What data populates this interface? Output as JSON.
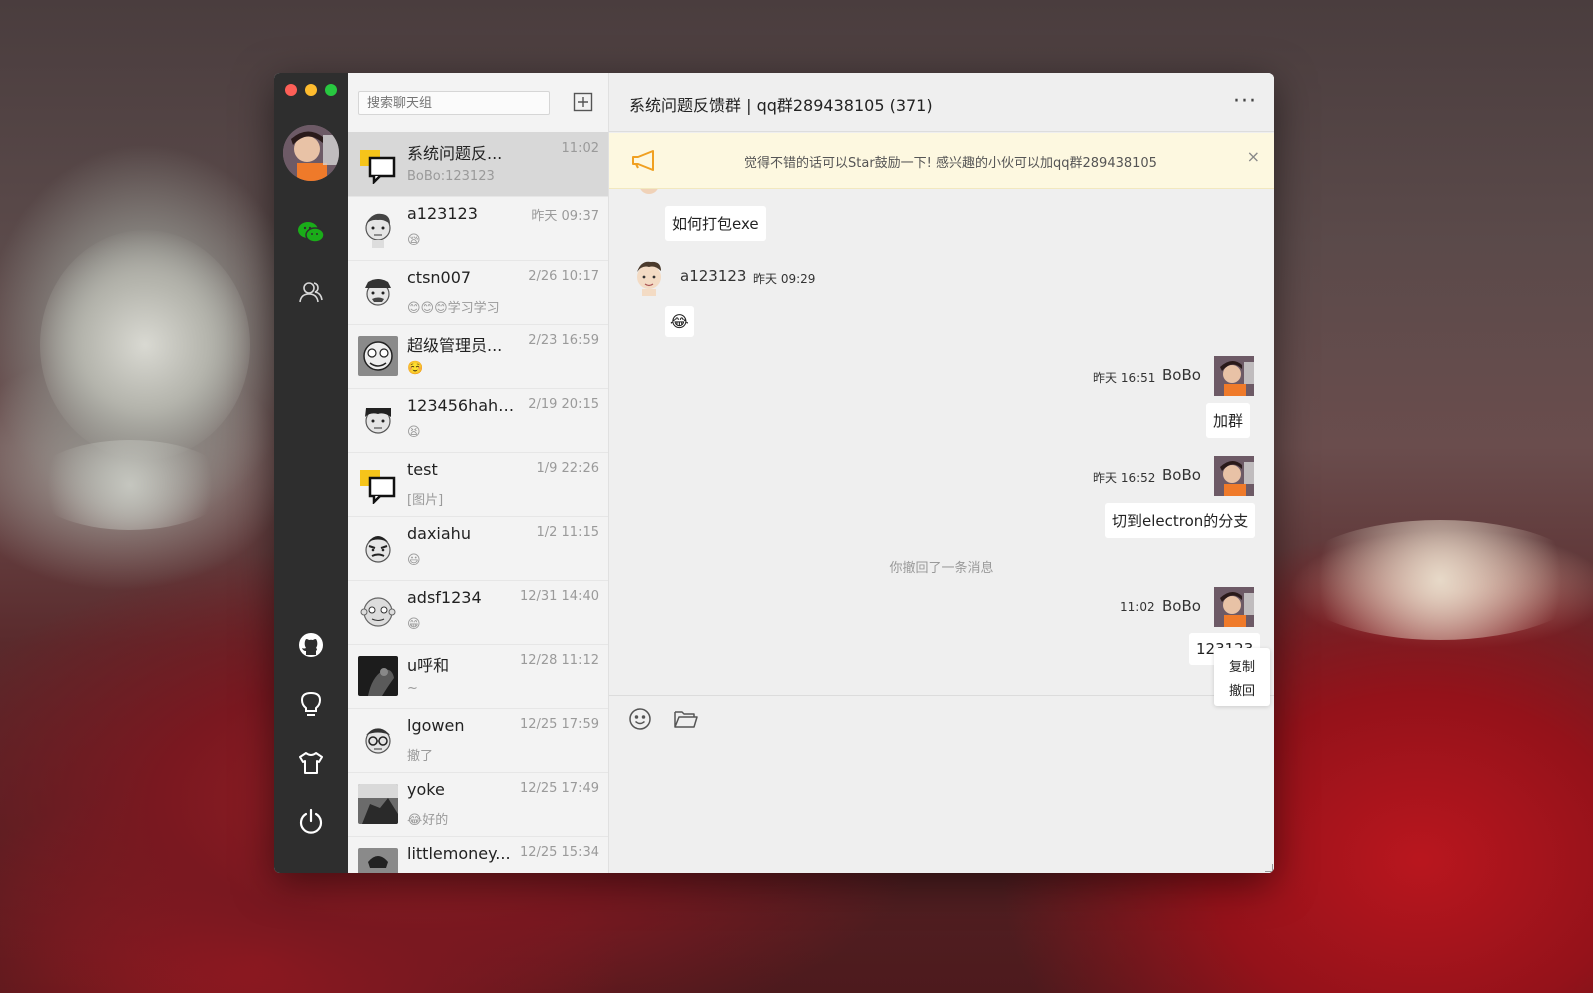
{
  "window": {
    "traffic_lights": [
      "#fd5f57",
      "#febc2e",
      "#28c840"
    ]
  },
  "sidebar": {
    "icons": [
      "wechat-icon",
      "contacts-icon",
      "github-icon",
      "bulb-icon",
      "tshirt-icon",
      "power-icon"
    ]
  },
  "search": {
    "placeholder": "搜索聊天组"
  },
  "conversations": [
    {
      "name": "系统问题反...",
      "time": "11:02",
      "msg": "BoBo:123123",
      "emoji": ""
    },
    {
      "name": "a123123",
      "time": "昨天 09:37",
      "msg": "",
      "emoji": "😪"
    },
    {
      "name": "ctsn007",
      "time": "2/26 10:17",
      "msg": "学习学习",
      "emoji": "😊😊😊"
    },
    {
      "name": "超级管理员...",
      "time": "2/23 16:59",
      "msg": "",
      "emoji": "☺️"
    },
    {
      "name": "123456haha...",
      "time": "2/19 20:15",
      "msg": "",
      "emoji": "😫"
    },
    {
      "name": "test",
      "time": "1/9 22:26",
      "msg": "[图片]",
      "emoji": ""
    },
    {
      "name": "daxiahu",
      "time": "1/2 11:15",
      "msg": "",
      "emoji": "😃"
    },
    {
      "name": "adsf1234",
      "time": "12/31 14:40",
      "msg": "",
      "emoji": "😁"
    },
    {
      "name": "u呼和",
      "time": "12/28 11:12",
      "msg": "~",
      "emoji": ""
    },
    {
      "name": "lgowen",
      "time": "12/25 17:59",
      "msg": "撤了",
      "emoji": ""
    },
    {
      "name": "yoke",
      "time": "12/25 17:49",
      "msg": "好的",
      "emoji": "😂"
    },
    {
      "name": "littlemoney...",
      "time": "12/25 15:34",
      "msg": "",
      "emoji": ""
    }
  ],
  "chat": {
    "title": "系统问题反馈群 | qq群289438105 (371)",
    "more": "···",
    "notice": "觉得不错的话可以Star鼓励一下! 感兴趣的小伙可以加qq群289438105",
    "notice_close": "×",
    "messages": {
      "m1_text": "如何打包exe",
      "m2_name": "a123123",
      "m2_time": "昨天 09:29",
      "m2_emoji": "😂",
      "m3_name": "BoBo",
      "m3_time": "昨天 16:51",
      "m3_text": "加群",
      "m4_name": "BoBo",
      "m4_time": "昨天 16:52",
      "m4_text": "切到electron的分支",
      "system": "你撤回了一条消息",
      "m5_name": "BoBo",
      "m5_time": "11:02",
      "m5_text": "123123"
    },
    "context_menu": [
      "复制",
      "撤回"
    ]
  }
}
